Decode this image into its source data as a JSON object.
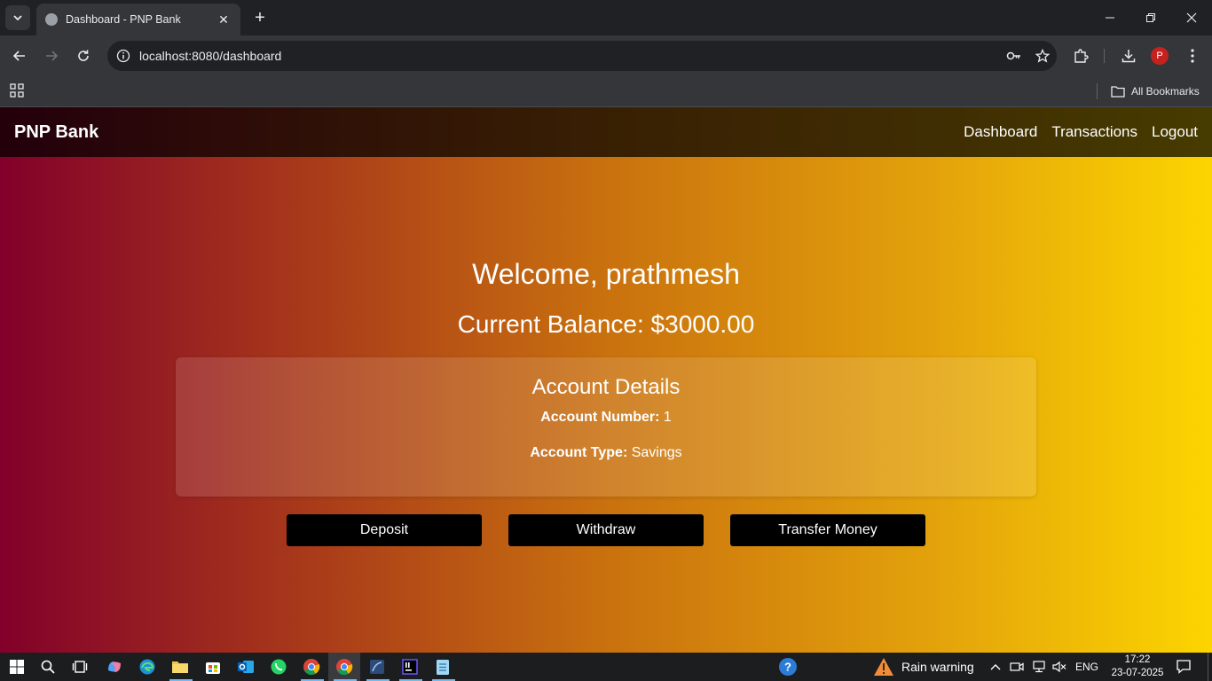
{
  "browser": {
    "tab_title": "Dashboard - PNP Bank",
    "url": "localhost:8080/dashboard",
    "profile_initial": "P",
    "all_bookmarks_label": "All Bookmarks"
  },
  "app": {
    "brand": "PNP Bank",
    "nav": [
      "Dashboard",
      "Transactions",
      "Logout"
    ],
    "welcome": "Welcome, prathmesh",
    "balance": "Current Balance: $3000.00",
    "account_card": {
      "title": "Account Details",
      "number_label": "Account Number:",
      "number_value": "1",
      "type_label": "Account Type:",
      "type_value": "Savings"
    },
    "actions": [
      "Deposit",
      "Withdraw",
      "Transfer Money"
    ],
    "colors": {
      "gradient_start": "#82002a",
      "gradient_end": "#fcd500",
      "button_bg": "#000000"
    }
  },
  "taskbar": {
    "weather": "Rain warning",
    "language": "ENG",
    "time": "17:22",
    "date": "23-07-2025"
  }
}
